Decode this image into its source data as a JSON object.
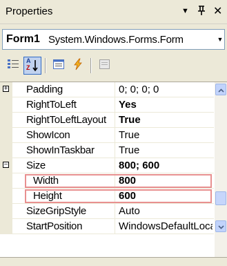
{
  "window": {
    "title": "Properties",
    "dropdown_glyph": "▼",
    "pin_glyph": "♯",
    "close_glyph": "✕"
  },
  "selector": {
    "object_name": "Form1",
    "object_type": "System.Windows.Forms.Form",
    "arrow_glyph": "▼"
  },
  "toolbar": {
    "buttons": [
      {
        "name": "categorized-button",
        "icon": "categorized-icon"
      },
      {
        "name": "alphabetical-button",
        "icon": "alphabetical-icon",
        "active": true,
        "label_top": "A",
        "label_bottom": "Z"
      },
      {
        "name": "properties-button",
        "icon": "properties-icon"
      },
      {
        "name": "events-button",
        "icon": "events-icon"
      },
      {
        "name": "property-pages-button",
        "icon": "property-pages-icon"
      }
    ]
  },
  "grid": {
    "expand_glyph": "+",
    "collapse_glyph": "−",
    "rows": [
      {
        "name": "Padding",
        "value": "0; 0; 0; 0",
        "bold": false,
        "expander": "+"
      },
      {
        "name": "RightToLeft",
        "value": "Yes",
        "bold": true
      },
      {
        "name": "RightToLeftLayout",
        "value": "True",
        "bold": true
      },
      {
        "name": "ShowIcon",
        "value": "True",
        "bold": false
      },
      {
        "name": "ShowInTaskbar",
        "value": "True",
        "bold": false
      },
      {
        "name": "Size",
        "value": "800; 600",
        "bold": true,
        "expander": "−"
      },
      {
        "name": "Width",
        "value": "800",
        "bold": true,
        "sub": true,
        "highlighted": true
      },
      {
        "name": "Height",
        "value": "600",
        "bold": true,
        "sub": true,
        "highlighted": true
      },
      {
        "name": "SizeGripStyle",
        "value": "Auto",
        "bold": false
      },
      {
        "name": "StartPosition",
        "value": "WindowsDefaultLocation",
        "bold": false
      }
    ]
  },
  "scrollbar": {
    "up_glyph": "⌃",
    "down_glyph": "⌄",
    "accent": "#4d6185"
  },
  "colors": {
    "panel": "#ece9d8",
    "highlight_border": "#e89090",
    "xp_blue": "#316ac5"
  }
}
